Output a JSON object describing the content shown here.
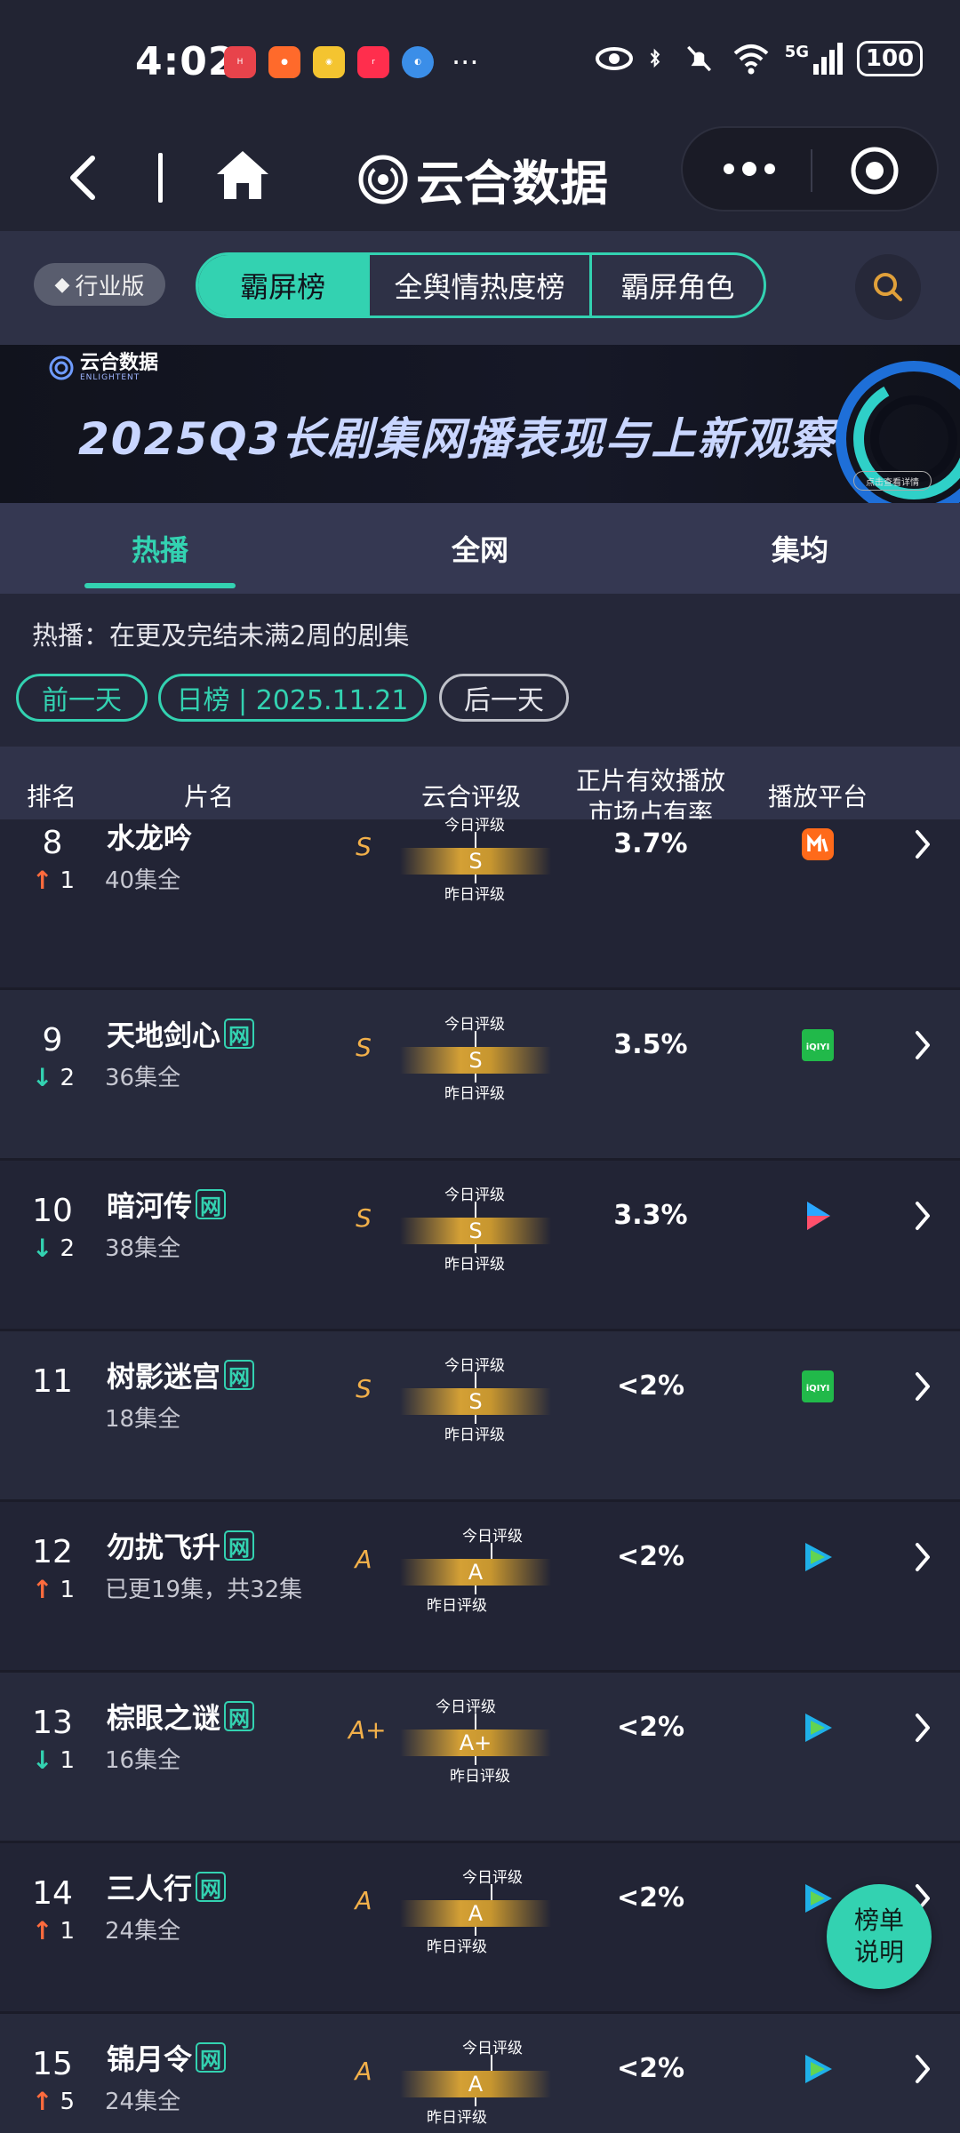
{
  "status_bar": {
    "time": "4:02",
    "battery": "100",
    "network": "5G"
  },
  "nav": {
    "title": "云合数据"
  },
  "filter": {
    "edition": "行业版",
    "segments": [
      "霸屏榜",
      "全舆情热度榜",
      "霸屏角色"
    ],
    "active_segment": "霸屏榜"
  },
  "banner": {
    "logo": "云合数据",
    "logo_sub": "ENLIGHTENT",
    "title": "2025Q3长剧集网播表现与上新观察",
    "button": "点击查看详情"
  },
  "tabs": [
    "热播",
    "全网",
    "集均"
  ],
  "active_tab": "热播",
  "info": {
    "description": "热播：在更及完结未满2周的剧集",
    "prev_day": "前一天",
    "date_label": "日榜 | 2025.11.21",
    "next_day": "后一天"
  },
  "table": {
    "headers": {
      "rank": "排名",
      "title": "片名",
      "rating": "云合评级",
      "share_line1": "正片有效播放",
      "share_line2": "市场占有率",
      "platform": "播放平台"
    },
    "today_label": "今日评级",
    "yesterday_label": "昨日评级",
    "net_badge": "网",
    "rows": [
      {
        "rank": "8",
        "dir": "up",
        "change": "1",
        "title": "水龙吟",
        "net": false,
        "episodes": "40集全",
        "grade": "S",
        "bar_grade": "S",
        "share": "3.7%",
        "platform": "mango-tv-icon"
      },
      {
        "rank": "9",
        "dir": "down",
        "change": "2",
        "title": "天地剑心",
        "net": true,
        "episodes": "36集全",
        "grade": "S",
        "bar_grade": "S",
        "share": "3.5%",
        "platform": "iqiyi-icon"
      },
      {
        "rank": "10",
        "dir": "down",
        "change": "2",
        "title": "暗河传",
        "net": true,
        "episodes": "38集全",
        "grade": "S",
        "bar_grade": "S",
        "share": "3.3%",
        "platform": "youku-icon"
      },
      {
        "rank": "11",
        "dir": "none",
        "change": "",
        "title": "树影迷宫",
        "net": true,
        "episodes": "18集全",
        "grade": "S",
        "bar_grade": "S",
        "share": "<2%",
        "platform": "iqiyi-icon"
      },
      {
        "rank": "12",
        "dir": "up",
        "change": "1",
        "title": "勿扰飞升",
        "net": true,
        "episodes": "已更19集，共32集",
        "grade": "A",
        "bar_grade": "A",
        "share": "<2%",
        "platform": "tencent-video-icon"
      },
      {
        "rank": "13",
        "dir": "down",
        "change": "1",
        "title": "棕眼之谜",
        "net": true,
        "episodes": "16集全",
        "grade": "A+",
        "bar_grade": "A+",
        "share": "<2%",
        "platform": "tencent-video-icon"
      },
      {
        "rank": "14",
        "dir": "up",
        "change": "1",
        "title": "三人行",
        "net": true,
        "episodes": "24集全",
        "grade": "A",
        "bar_grade": "A",
        "share": "<2%",
        "platform": "tencent-video-icon"
      },
      {
        "rank": "15",
        "dir": "up",
        "change": "5",
        "title": "锦月令",
        "net": true,
        "episodes": "24集全",
        "grade": "A",
        "bar_grade": "A",
        "share": "<2%",
        "platform": "tencent-video-icon"
      }
    ]
  },
  "fab": {
    "line1": "榜单",
    "line2": "说明"
  }
}
